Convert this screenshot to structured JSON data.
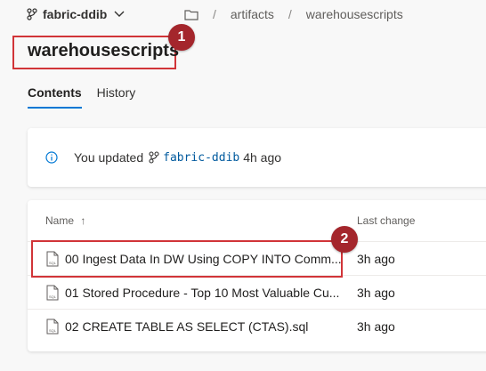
{
  "topbar": {
    "branch_name": "fabric-ddib",
    "breadcrumbs": [
      "artifacts",
      "warehousescripts"
    ]
  },
  "page": {
    "title": "warehousescripts",
    "callout_title": "1",
    "callout_row": "2"
  },
  "tabs": [
    {
      "label": "Contents",
      "active": true
    },
    {
      "label": "History",
      "active": false
    }
  ],
  "banner": {
    "prefix": "You updated",
    "branch": "fabric-ddib",
    "suffix": "4h ago"
  },
  "table": {
    "col_name": "Name",
    "sort_indicator": "↑",
    "col_last_change": "Last change",
    "rows": [
      {
        "name": "00 Ingest Data In DW Using COPY INTO Comm...",
        "time": "3h ago"
      },
      {
        "name": "01 Stored Procedure - Top 10 Most Valuable Cu...",
        "time": "3h ago"
      },
      {
        "name": "02 CREATE TABLE AS SELECT (CTAS).sql",
        "time": "3h ago"
      }
    ]
  },
  "icons": {
    "branch": "branch-icon",
    "chevron": "chevron-down-icon",
    "folder": "folder-icon",
    "info": "info-icon",
    "file": "sql-file-icon"
  },
  "colors": {
    "accent": "#0078d4",
    "annotation": "#d13438",
    "badge": "#a4262c"
  }
}
